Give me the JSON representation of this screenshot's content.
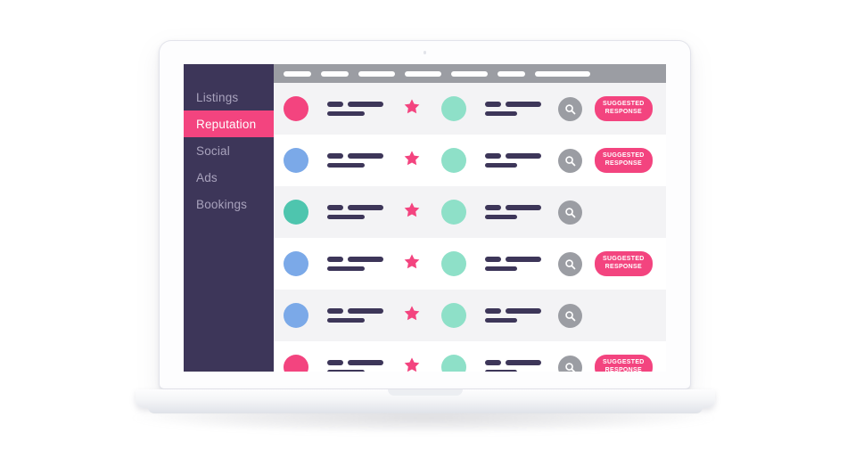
{
  "device": {
    "type": "laptop",
    "frame_color": "#fdfdfe",
    "camera": "camera-dot"
  },
  "app": {
    "sidebar": {
      "background": "#3d3659",
      "active_color": "#f3447f",
      "text_color": "#a9a3bd",
      "items": [
        {
          "label": "Listings",
          "active": false
        },
        {
          "label": "Reputation",
          "active": true
        },
        {
          "label": "Social",
          "active": false
        },
        {
          "label": "Ads",
          "active": false
        },
        {
          "label": "Bookings",
          "active": false
        }
      ]
    },
    "table": {
      "header": {
        "background": "#9b9da3",
        "pill_color": "#ffffff",
        "pill_widths": [
          31,
          31,
          41,
          41,
          41,
          31,
          62
        ]
      },
      "columns": [
        "avatar",
        "name-lines",
        "rating-star",
        "status-dot",
        "detail-lines",
        "search-action",
        "response-action"
      ],
      "row_colors": {
        "odd": "#f3f3f5",
        "even": "#ffffff"
      },
      "colors": {
        "avatar_pink": "#f3447f",
        "avatar_blue": "#7ba9e8",
        "avatar_teal": "#4ec5ae",
        "dot_mint": "#8ee0c8",
        "star_pink": "#f3447f",
        "bar_navy": "#3d3659",
        "search_grey": "#9b9da3",
        "button_pink": "#f3447f"
      },
      "action_button_label": "SUGGESTED\nRESPONSE",
      "rows": [
        {
          "avatar": "#f3447f",
          "bars": [
            18,
            40,
            42
          ],
          "star": true,
          "dot": "#8ee0c8",
          "bars2": [
            18,
            40,
            36
          ],
          "search": true,
          "button": true,
          "shade": "odd"
        },
        {
          "avatar": "#7ba9e8",
          "bars": [
            18,
            40,
            42
          ],
          "star": true,
          "dot": "#8ee0c8",
          "bars2": [
            18,
            40,
            36
          ],
          "search": true,
          "button": true,
          "shade": "even"
        },
        {
          "avatar": "#4ec5ae",
          "bars": [
            18,
            40,
            42
          ],
          "star": true,
          "dot": "#8ee0c8",
          "bars2": [
            18,
            40,
            36
          ],
          "search": true,
          "button": false,
          "shade": "odd"
        },
        {
          "avatar": "#7ba9e8",
          "bars": [
            18,
            40,
            42
          ],
          "star": true,
          "dot": "#8ee0c8",
          "bars2": [
            18,
            40,
            36
          ],
          "search": true,
          "button": true,
          "shade": "even"
        },
        {
          "avatar": "#7ba9e8",
          "bars": [
            18,
            40,
            42
          ],
          "star": true,
          "dot": "#8ee0c8",
          "bars2": [
            18,
            40,
            36
          ],
          "search": true,
          "button": false,
          "shade": "odd"
        },
        {
          "avatar": "#f3447f",
          "bars": [
            18,
            40,
            42
          ],
          "star": true,
          "dot": "#8ee0c8",
          "bars2": [
            18,
            40,
            36
          ],
          "search": true,
          "button": true,
          "shade": "even"
        }
      ]
    }
  }
}
